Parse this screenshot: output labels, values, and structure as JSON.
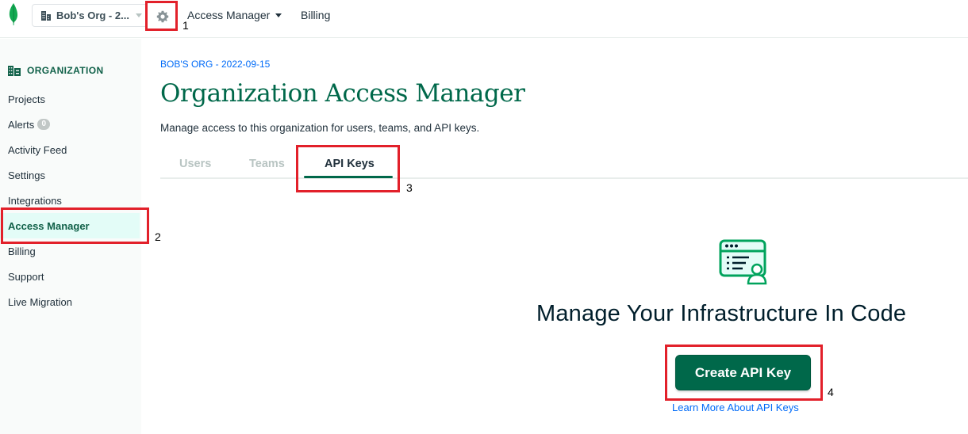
{
  "topbar": {
    "org_name": "Bob's Org - 2...",
    "nav": [
      {
        "label": "Access Manager"
      },
      {
        "label": "Billing"
      }
    ]
  },
  "sidebar": {
    "section_title": "ORGANIZATION",
    "items": [
      {
        "label": "Projects"
      },
      {
        "label": "Alerts",
        "badge": "0"
      },
      {
        "label": "Activity Feed"
      },
      {
        "label": "Settings"
      },
      {
        "label": "Integrations"
      },
      {
        "label": "Access Manager",
        "active": true
      },
      {
        "label": "Billing"
      },
      {
        "label": "Support"
      },
      {
        "label": "Live Migration"
      }
    ]
  },
  "main": {
    "breadcrumb": "BOB'S ORG - 2022-09-15",
    "title": "Organization Access Manager",
    "description": "Manage access to this organization for users, teams, and API keys.",
    "tabs": [
      {
        "label": "Users"
      },
      {
        "label": "Teams"
      },
      {
        "label": "API Keys",
        "active": true
      }
    ],
    "empty_state": {
      "title": "Manage Your Infrastructure In Code",
      "button": "Create API Key",
      "link": "Learn More About API Keys"
    }
  },
  "annotations": [
    "1",
    "2",
    "3",
    "4"
  ],
  "colors": {
    "brand_green": "#00684a",
    "link_blue": "#016bf8",
    "highlight_red": "#e2202a",
    "active_bg": "#e3fcf7"
  }
}
